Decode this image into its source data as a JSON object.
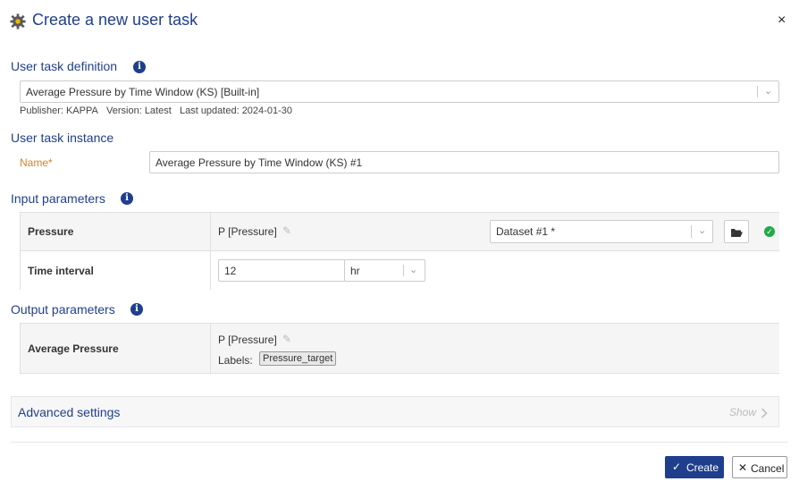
{
  "dialog": {
    "title": "Create a new user task",
    "close": "×"
  },
  "definition": {
    "heading": "User task definition",
    "info": "i",
    "selected": "Average Pressure by Time Window (KS) [Built-in]",
    "meta": {
      "publisher": "Publisher: KAPPA",
      "version": "Version: Latest",
      "updated": "Last updated: 2024-01-30"
    }
  },
  "instance": {
    "heading": "User task instance",
    "name_label": "Name",
    "required_mark": "*",
    "name_value": "Average Pressure by Time Window (KS) #1"
  },
  "inputs": {
    "heading": "Input parameters",
    "info": "i",
    "rows": [
      {
        "label": "Pressure",
        "value": "P [Pressure]",
        "dataset": "Dataset #1 *"
      },
      {
        "label": "Time interval",
        "value": "12",
        "unit": "hr"
      }
    ]
  },
  "outputs": {
    "heading": "Output parameters",
    "info": "i",
    "rows": [
      {
        "label": "Average Pressure",
        "value": "P [Pressure]",
        "labels_title": "Labels:",
        "tag": "Pressure_target"
      }
    ]
  },
  "advanced": {
    "title": "Advanced settings",
    "toggle": "Show"
  },
  "footer": {
    "create": "Create",
    "cancel": "Cancel"
  },
  "colors": {
    "accent": "#1f3f8c",
    "required": "#d9822b",
    "success": "#22a94a"
  }
}
